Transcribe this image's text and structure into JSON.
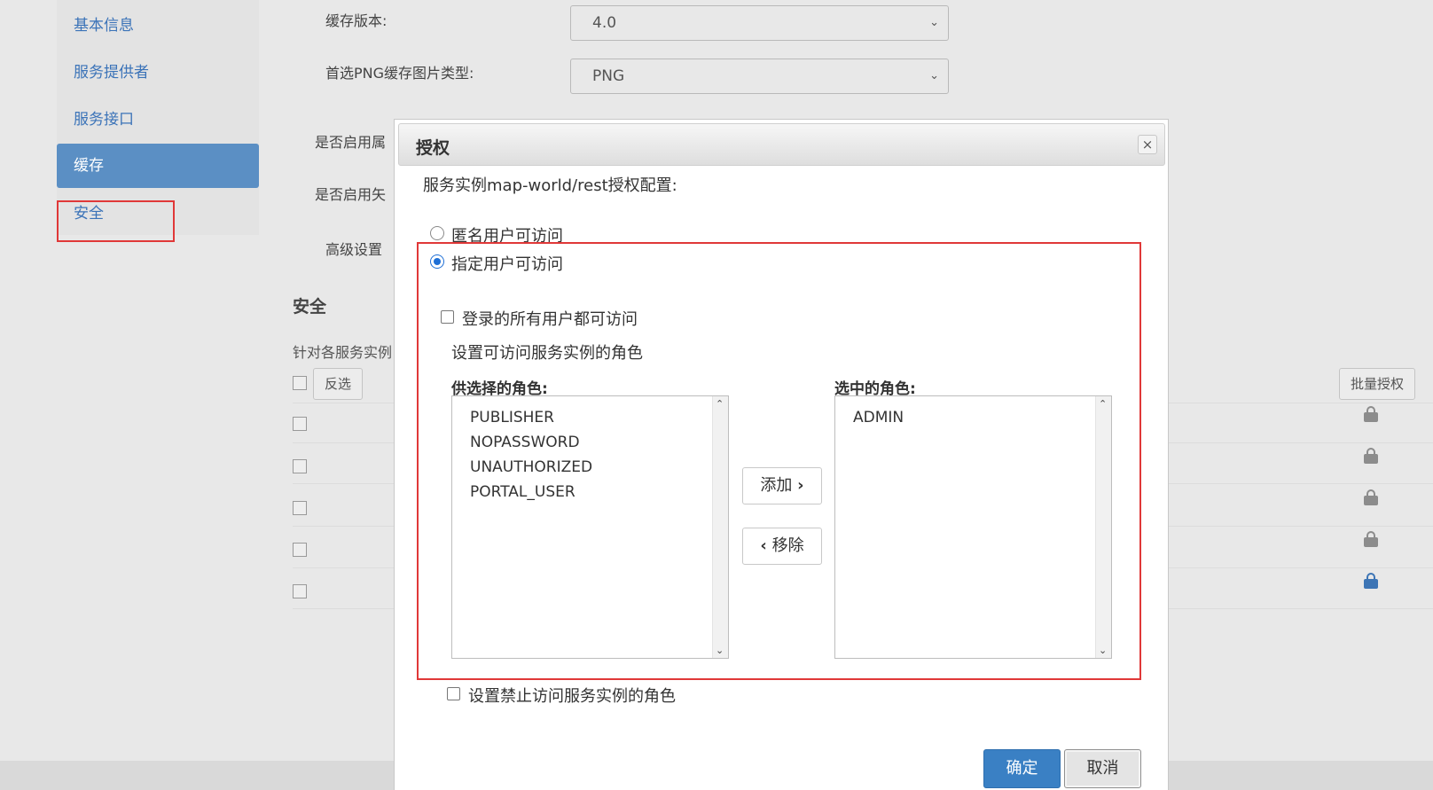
{
  "sidebar": {
    "items": [
      {
        "label": "基本信息"
      },
      {
        "label": "服务提供者"
      },
      {
        "label": "服务接口"
      },
      {
        "label": "缓存"
      },
      {
        "label": "安全"
      }
    ],
    "active_index": 3
  },
  "background_form": {
    "cache_version_label": "缓存版本:",
    "cache_version_value": "4.0",
    "png_type_label": "首选PNG缓存图片类型:",
    "png_type_value": "PNG",
    "enable_attr_label": "是否启用属",
    "enable_vector_label": "是否启用矢",
    "advanced_label": "高级设置",
    "section_title": "安全",
    "section_desc": "针对各服务实例",
    "invert_select_label": "反选",
    "batch_auth_label": "批量授权"
  },
  "dialog": {
    "title": "授权",
    "close_symbol": "×",
    "config_heading": "服务实例map-world/rest授权配置:",
    "anonymous_option": "匿名用户可访问",
    "specified_option": "指定用户可访问",
    "selected_radio": "specified",
    "all_logged_in_label": "登录的所有用户都可访问",
    "set_roles_label": "设置可访问服务实例的角色",
    "available_roles_title": "供选择的角色:",
    "available_roles": [
      "PUBLISHER",
      "NOPASSWORD",
      "UNAUTHORIZED",
      "PORTAL_USER"
    ],
    "selected_roles_title": "选中的角色:",
    "selected_roles": [
      "ADMIN"
    ],
    "add_label": "添加",
    "remove_label": "移除",
    "deny_roles_label": "设置禁止访问服务实例的角色",
    "ok_label": "确定",
    "cancel_label": "取消"
  },
  "colors": {
    "highlight_border": "#e03838",
    "primary_button": "#3a80c4",
    "sidebar_active": "#5b8fc4",
    "link": "#3b73b8"
  }
}
